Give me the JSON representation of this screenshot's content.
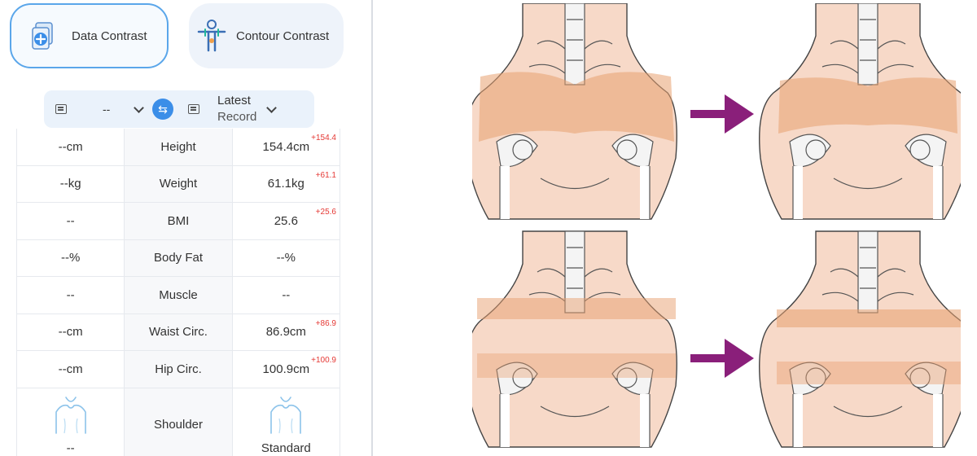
{
  "modes": {
    "data_contrast": "Data Contrast",
    "contour_contrast": "Contour Contrast"
  },
  "selector": {
    "left_value": "--",
    "right_line1": "Latest",
    "right_line2": "Record"
  },
  "rows": [
    {
      "left": "--cm",
      "label": "Height",
      "right": "154.4cm",
      "delta": "+154.4"
    },
    {
      "left": "--kg",
      "label": "Weight",
      "right": "61.1kg",
      "delta": "+61.1"
    },
    {
      "left": "--",
      "label": "BMI",
      "right": "25.6",
      "delta": "+25.6"
    },
    {
      "left": "--%",
      "label": "Body Fat",
      "right": "--%",
      "delta": ""
    },
    {
      "left": "--",
      "label": "Muscle",
      "right": "--",
      "delta": ""
    },
    {
      "left": "--cm",
      "label": "Waist Circ.",
      "right": "86.9cm",
      "delta": "+86.9"
    },
    {
      "left": "--cm",
      "label": "Hip Circ.",
      "right": "100.9cm",
      "delta": "+100.9"
    }
  ],
  "shoulder": {
    "label": "Shoulder",
    "left": "--",
    "right": "Standard"
  },
  "colors": {
    "accent": "#3b8ee8",
    "delta": "#e53935",
    "arrow": "#8a1f7a",
    "skin": "#f6d6c4",
    "bone": "#f2f2f2",
    "muscle": "#e8a070"
  }
}
